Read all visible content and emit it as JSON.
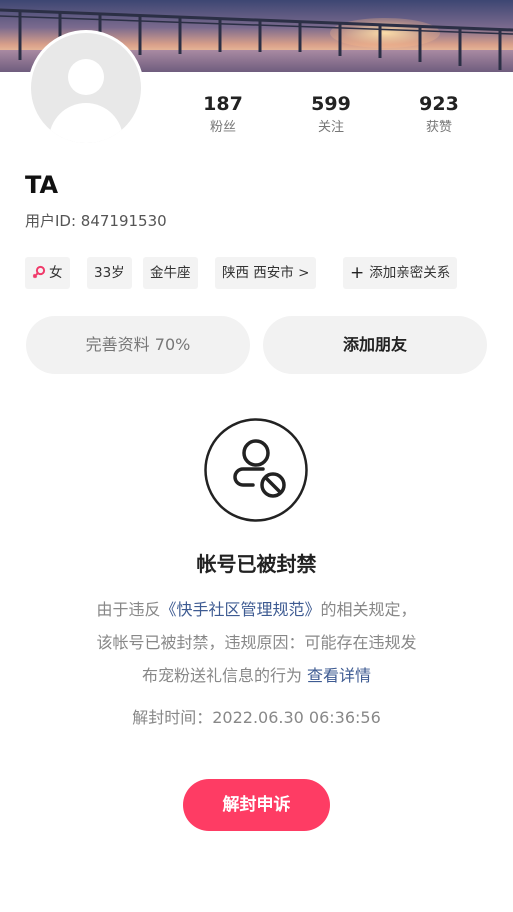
{
  "profile": {
    "stats": [
      {
        "value": "187",
        "label": "粉丝"
      },
      {
        "value": "599",
        "label": "关注"
      },
      {
        "value": "923",
        "label": "获赞"
      }
    ],
    "name": "TA",
    "user_id": "用户ID: 847191530",
    "tags": {
      "gender": "女",
      "age": "33岁",
      "zodiac": "金牛座",
      "location": "陕西 西安市 >",
      "add_relation": "添加亲密关系"
    },
    "complete_profile": "完善资料 70%",
    "add_friend": "添加朋友"
  },
  "ban": {
    "title": "帐号已被封禁",
    "line1_prefix": "由于违反",
    "line1_link": "《快手社区管理规范》",
    "line1_suffix": "的相关规定，",
    "line2": "该帐号已被封禁，违规原因：可能存在违规发",
    "line3_text": "布宠粉送礼信息的行为",
    "line3_link": "查看详情",
    "unban_time": "解封时间：2022.06.30 06:36:56",
    "appeal_button": "解封申诉"
  },
  "colors": {
    "accent": "#fe3c64",
    "link": "#3e5b92",
    "female_icon": "#f03a6a"
  }
}
